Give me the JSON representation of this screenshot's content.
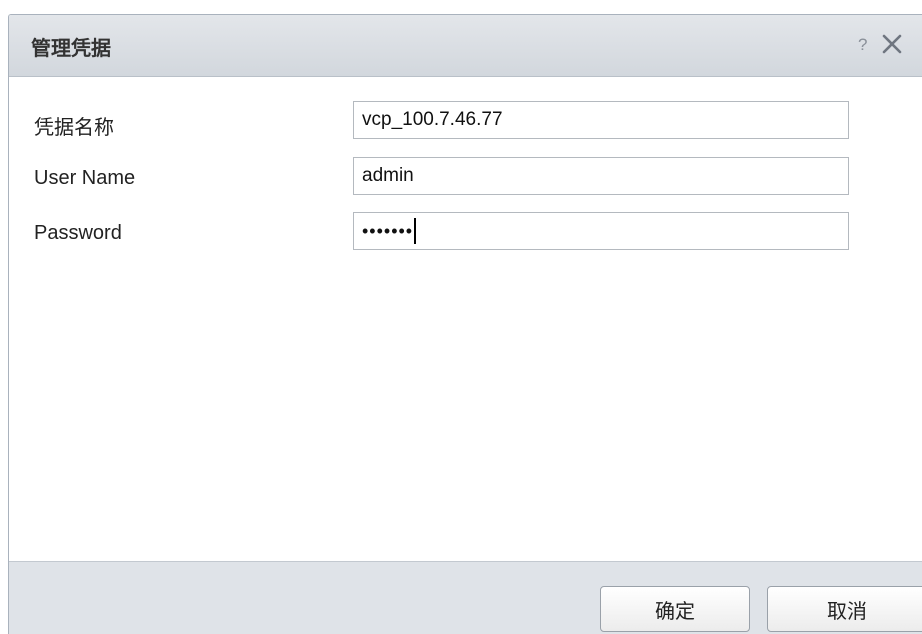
{
  "dialog": {
    "title": "管理凭据",
    "help_label": "?",
    "close_icon": "close-icon"
  },
  "form": {
    "credential_name": {
      "label": "凭据名称",
      "value": "vcp_100.7.46.77"
    },
    "username": {
      "label": "User Name",
      "value": "admin"
    },
    "password": {
      "label": "Password",
      "masked_value": "•••••••"
    }
  },
  "footer": {
    "ok_label": "确定",
    "cancel_label": "取消"
  },
  "colors": {
    "titlebar": "#d9dde2",
    "footer": "#dfe3e8",
    "border": "#b4b9bf"
  }
}
